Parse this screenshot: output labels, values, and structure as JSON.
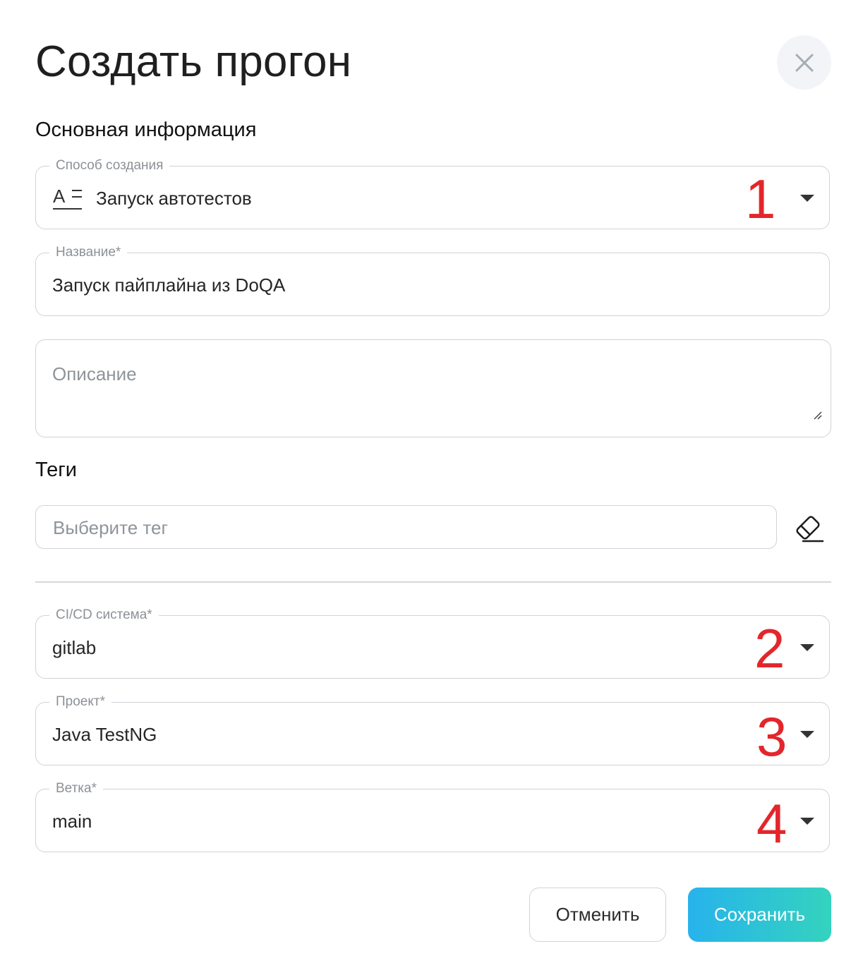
{
  "dialog": {
    "title": "Создать прогон"
  },
  "sections": {
    "main_info": "Основная информация",
    "tags": "Теги"
  },
  "fields": {
    "creation_method": {
      "label": "Способ создания",
      "value": "Запуск автотестов",
      "icon": "autotest-text-icon",
      "marker": "1"
    },
    "name": {
      "label": "Название*",
      "value": "Запуск пайплайна из DoQA"
    },
    "description": {
      "placeholder": "Описание"
    },
    "tags": {
      "placeholder": "Выберите тег",
      "clear_icon": "eraser-icon"
    },
    "ci_system": {
      "label": "CI/CD система*",
      "value": "gitlab",
      "marker": "2"
    },
    "project": {
      "label": "Проект*",
      "value": "Java TestNG",
      "marker": "3"
    },
    "branch": {
      "label": "Ветка*",
      "value": "main",
      "marker": "4"
    }
  },
  "buttons": {
    "cancel": "Отменить",
    "save": "Сохранить"
  },
  "colors": {
    "marker": "#e3262b",
    "save_gradient_start": "#27b3ec",
    "save_gradient_end": "#34d3be"
  }
}
